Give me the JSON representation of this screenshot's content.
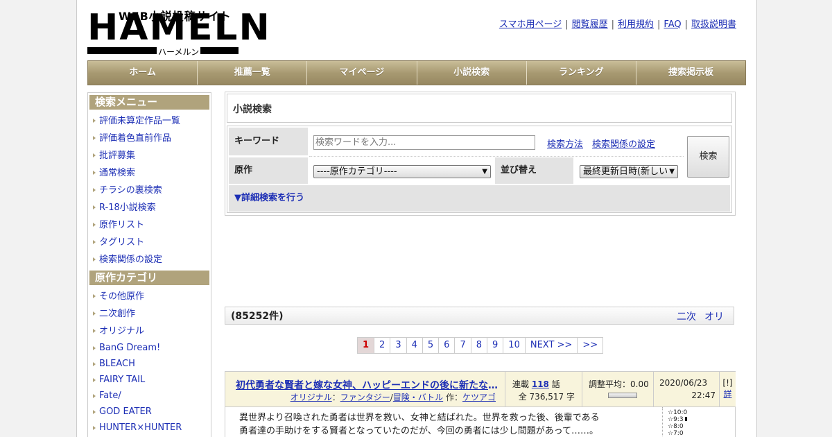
{
  "logo": {
    "main": "HAMELN",
    "sub": "WEB小説投稿サイト",
    "kana": "ハーメルン"
  },
  "top_links": [
    "スマホ用ページ",
    "閲覧履歴",
    "利用規約",
    "FAQ",
    "取扱説明書"
  ],
  "nav": [
    "ホーム",
    "推薦一覧",
    "マイページ",
    "小説検索",
    "ランキング",
    "捜索掲示板"
  ],
  "sidebar": {
    "menu_title": "検索メニュー",
    "menu_items": [
      "評価未算定作品一覧",
      "評価着色直前作品",
      "批評募集",
      "通常検索",
      "チラシの裏検索",
      "R-18小説検索",
      "原作リスト",
      "タグリスト",
      "検索関係の設定"
    ],
    "category_title": "原作カテゴリ",
    "category_items": [
      "その他原作",
      "二次創作",
      "オリジナル",
      "BanG Dream!",
      "BLEACH",
      "FAIRY TAIL",
      "Fate/",
      "GOD EATER",
      "HUNTER×HUNTER"
    ]
  },
  "search": {
    "title": "小説検索",
    "keyword_label": "キーワード",
    "keyword_placeholder": "検索ワードを入力...",
    "link_method": "検索方法",
    "link_settings": "検索関係の設定",
    "source_label": "原作",
    "source_value": "----原作カテゴリ----",
    "sort_label": "並び替え",
    "sort_value": "最終更新日時(新しい",
    "button": "検索",
    "detail_link": "▼詳細検索を行う"
  },
  "count": {
    "text": "(85252件)",
    "links": [
      "二次",
      "オリ"
    ]
  },
  "pager": {
    "current": "1",
    "pages": [
      "2",
      "3",
      "4",
      "5",
      "6",
      "7",
      "8",
      "9",
      "10"
    ],
    "next": "NEXT >>",
    "last": ">>"
  },
  "novel": {
    "title": "初代勇者な賢者と嫁な女神、ハッピーエンドの後に新たな物語",
    "genre_orig": "オリジナル",
    "colon": "：",
    "genre_main": "ファンタジー",
    "slash": "/",
    "genre_sub": "冒険・バトル",
    "author_label": " 作：",
    "author": "ケツアゴ",
    "status": "連載",
    "episodes": "118",
    "episodes_unit": "話",
    "chars": "全 736,517 字",
    "rating_label": "調整平均：0.00",
    "date": "2020/06/23",
    "time": "22:47",
    "flag": "[!]",
    "detail": "詳",
    "summary_1": "異世界より召喚された勇者は世界を救い、女神と結ばれた。世界を救った後、後輩である",
    "summary_2": "勇者達の手助けをする賢者となっていたのだが、今回の勇者には少し問題があって……。",
    "stars": [
      "☆10:0",
      "☆9:3",
      "☆8:0",
      "☆7:0"
    ]
  }
}
